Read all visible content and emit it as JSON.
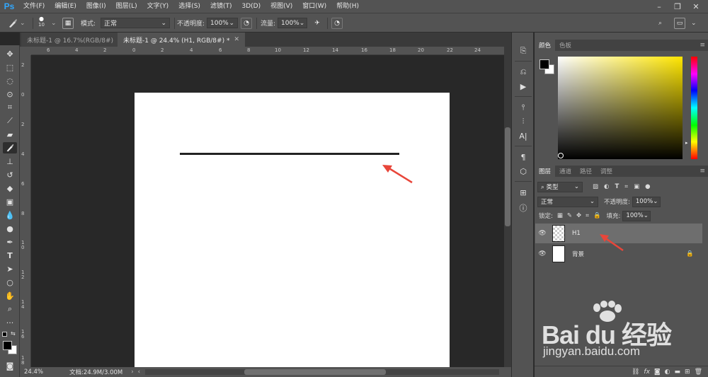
{
  "app": {
    "logo": "Ps"
  },
  "menu": [
    "文件(F)",
    "编辑(E)",
    "图像(I)",
    "图层(L)",
    "文字(Y)",
    "选择(S)",
    "滤镜(T)",
    "3D(D)",
    "视图(V)",
    "窗口(W)",
    "帮助(H)"
  ],
  "options": {
    "brush_size": "10",
    "mode_label": "模式:",
    "mode_value": "正常",
    "opacity_label": "不透明度:",
    "opacity_value": "100%",
    "flow_label": "流量:",
    "flow_value": "100%"
  },
  "tabs": [
    {
      "label": "未标题-1 @ 16.7%(RGB/8#)",
      "active": false
    },
    {
      "label": "未标题-1 @ 24.4% (H1, RGB/8#) *",
      "active": true
    }
  ],
  "ruler": {
    "top": [
      "6",
      "4",
      "2",
      "0",
      "2",
      "4",
      "6",
      "8",
      "10",
      "12",
      "14",
      "16",
      "18",
      "20",
      "22",
      "24"
    ],
    "left": [
      "2",
      "0",
      "2",
      "4",
      "6",
      "8",
      "1 0",
      "1 2",
      "1 4",
      "1 6",
      "1 8"
    ]
  },
  "status": {
    "zoom": "24.4%",
    "doc_info": "文档:24.9M/3.00M"
  },
  "color_panel": {
    "tabs": [
      "颜色",
      "色板"
    ],
    "fg": "#000000",
    "bg": "#ffffff"
  },
  "layers_panel": {
    "tabs": [
      "图层",
      "通道",
      "路径",
      "调整"
    ],
    "filter_label": "类型",
    "blend_mode": "正常",
    "opacity_label": "不透明度:",
    "opacity_value": "100%",
    "lock_label": "锁定:",
    "fill_label": "填充:",
    "fill_value": "100%",
    "layers": [
      {
        "name": "H1",
        "selected": true
      },
      {
        "name": "背景",
        "selected": false
      }
    ]
  },
  "watermark": {
    "main": "Bai du 经验",
    "sub": "jingyan.baidu.com"
  }
}
